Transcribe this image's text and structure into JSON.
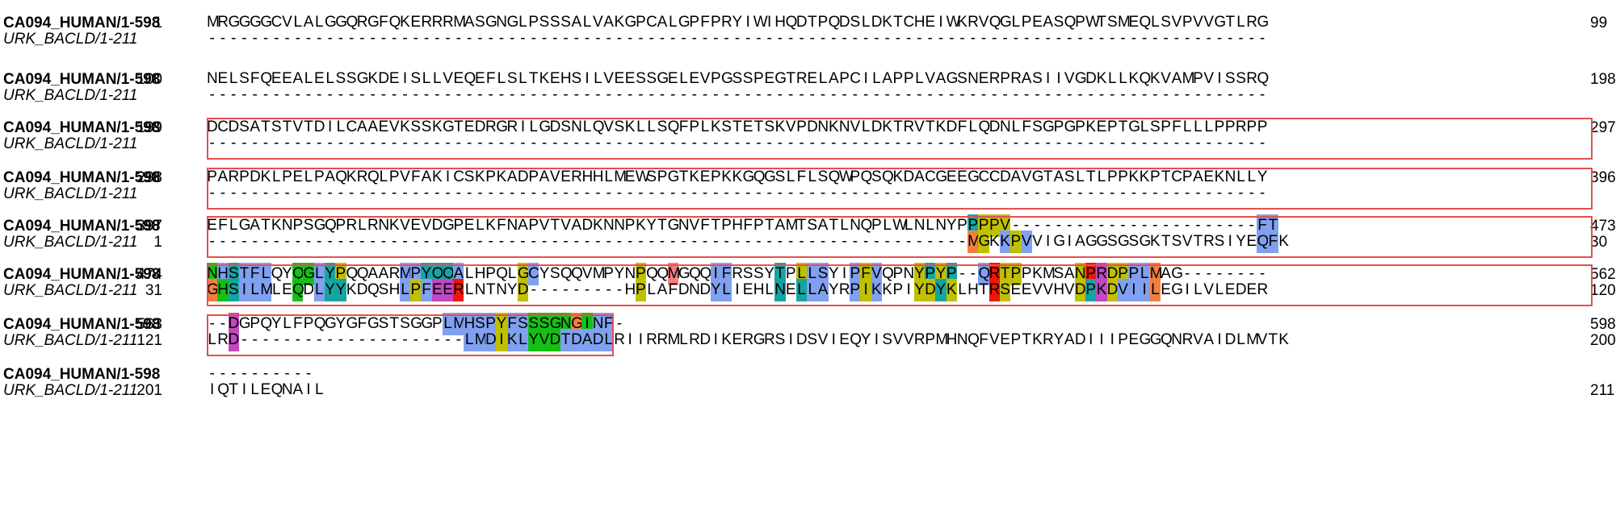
{
  "blocks": [
    {
      "name1": "CA094_HUMAN/1-598",
      "start1": "1",
      "seq1": "MRGGGGCVLALGGQRGFQKERRRMASGNGLPSSSALVAKGPCALGPFPRYIWIHQDTPQDSLDKTCHEIWKRVQGLPEASQPWTSMEQLSVPVVGTLRG",
      "end1": "99",
      "name2": "URK_BACLD/1-211",
      "start2": "",
      "seq2": "---------------------------------------------------------------------------------------------------",
      "end2": "",
      "colors1": "",
      "colors2": ""
    },
    {
      "name1": "CA094_HUMAN/1-598",
      "start1": "100",
      "seq1": "NELSFQEEALELSSGKDEISLLVEQEFLSLTKEHSILVEESSGELEVPGSSPEGTRELAPCILAPPLVAGSNERPRASIIVGDKLLKQKVAMPVISSRQ",
      "end1": "198",
      "name2": "URK_BACLD/1-211",
      "start2": "",
      "seq2": "---------------------------------------------------------------------------------------------------",
      "end2": "",
      "colors1": "",
      "colors2": ""
    },
    {
      "name1": "CA094_HUMAN/1-598",
      "start1": "199",
      "seq1": "DCDSATSTVTDILCAAEVKSSKGTEDRGRILGDSNLQVSKLLSQFPLKSTETSKVPDNKNVLDKTRVTKDFLQDNLFSGPGPKEPTGLSPFLLLPPRPP",
      "end1": "297",
      "name2": "URK_BACLD/1-211",
      "start2": "",
      "seq2": "---------------------------------------------------------------------------------------------------",
      "end2": "",
      "colors1": "",
      "colors2": ""
    },
    {
      "name1": "CA094_HUMAN/1-598",
      "start1": "298",
      "seq1": "PARPDKLPELPAQKRQLPVFAKICSKPKADPAVERHHLMEWSPGTKEPKKGQGSLFLSQWPQSQKDACGEEGCCDAVGTASLTLPPKKPTCPAEKNLLY",
      "end1": "396",
      "name2": "URK_BACLD/1-211",
      "start2": "",
      "seq2": "---------------------------------------------------------------------------------------------------",
      "end2": "",
      "colors1": "",
      "colors2": ""
    },
    {
      "name1": "CA094_HUMAN/1-598",
      "start1": "397",
      "seq1": "EFLGATKNPSGQPRLRNKVEVDGPELKFNAPVTVADKNNPKYTGNVFTPHFPTAMTSATLNQPLWLNLNYPPPPV-----------------------FT",
      "end1": "473",
      "name2": "URK_BACLD/1-211",
      "start2": "1",
      "seq2": "-----------------------------------------------------------------------MGKKPVVIGIAGGSGSGKTSVTRSIYEQFK",
      "end2": "30",
      "colors1": ".......................................................................cyyyyb.......................bb",
      "colors2": ".......................................................................oy.byb.......................bb"
    },
    {
      "name1": "CA094_HUMAN/1-598",
      "start1": "474",
      "seq1": "NHSTFLQYQGLYPQQAARMPYQQALHPQLGCYSQQVMPYNPQQMGQQIFRSSYTPLLSYIPFVQPNYPYP--QRTPPKMSANPRDPPLMAG--------",
      "end1": "562",
      "name2": "URK_BACLD/1-211",
      "start2": "31",
      "seq2": "GHSILMLEQDLYYKDQSHLPFEERLNTNYD---------HPLAFDNDYLIEHLNELLAYRPIKKPIYDYKLHTRSEEVVHVDPKDVIILEGILVLEDER",
      "end2": "120",
      "colors1": "gbbbbbbbgbbbbbbbbbbbbbbbbbbbbbbbbbbbbbbbbbbbbbbbbbbbbbbbbbbbbbbbbbbbbbbbbbbbbbbbbbbbbbbbbbbbbbbbb",
      "colors2": "o...................................................................................................."
    },
    {
      "name1": "CA094_HUMAN/1-598",
      "start1": "563",
      "seq1": "--DGPQYLFPQGYGFGSTSGGPLMHSPYFSSSGNGINF-",
      "end1": "598",
      "name2": "URK_BACLD/1-211",
      "start2": "121",
      "seq2": "LRD---------------------LMDIKLYVDTDADLRIIRRMLRDIKERGRSIDSVIEQYISVVRPMHNQFVEPTKRYADIIIPEGGQNRVAIDLMVTK",
      "end2": "200",
      "colors1": "..m.................................bbbb",
      "colors2": "..m.................................bbbb"
    },
    {
      "name1": "CA094_HUMAN/1-598",
      "start1": "",
      "seq1": "----------",
      "end1": "",
      "name2": "URK_BACLD/1-211",
      "start2": "201",
      "seq2": "IQTILEQNAIL",
      "end2": "211",
      "colors1": "",
      "colors2": ""
    }
  ],
  "palette": {
    "b": "#80a0f0",
    "g": "#15c015",
    "y": "#c0c000",
    "c": "#15a4a4",
    "o": "#f08040",
    "m": "#c048c0",
    "p": "#c0c000",
    "r": "#f01505",
    "k": "#f08080"
  },
  "frame_color": "#e35050"
}
